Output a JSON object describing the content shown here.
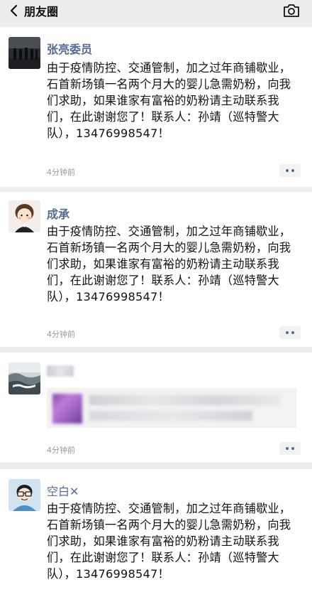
{
  "header": {
    "title": "朋友圈",
    "back_icon": "chevron-left-icon",
    "camera_icon": "camera-icon"
  },
  "posts": [
    {
      "author": "张亮委员",
      "content": "由于疫情防控、交通管制，加之过年商铺歇业，石首新场镇一名两个月大的婴儿急需奶粉，向我们求助，如果谁家有富裕的奶粉请主动联系我们，在此谢谢您了！联系人：孙靖（巡特警大队），13476998547！",
      "time": "4分钟前"
    },
    {
      "author": "成承",
      "content": "由于疫情防控、交通管制，加之过年商铺歇业，石首新场镇一名两个月大的婴儿急需奶粉，向我们求助，如果谁家有富裕的奶粉请主动联系我们，在此谢谢您了！联系人：孙靖（巡特警大队），13476998547！",
      "time": "4分钟前"
    },
    {
      "author": "",
      "content": "",
      "time": "4分钟前"
    },
    {
      "author": "空白✕",
      "content": "由于疫情防控、交通管制，加之过年商铺歇业，石首新场镇一名两个月大的婴儿急需奶粉，向我们求助，如果谁家有富裕的奶粉请主动联系我们，在此谢谢您了！联系人：孙靖（巡特警大队），13476998547！",
      "time": ""
    }
  ],
  "colors": {
    "name": "#576b95",
    "background": "#ededed",
    "card": "#ffffff"
  }
}
